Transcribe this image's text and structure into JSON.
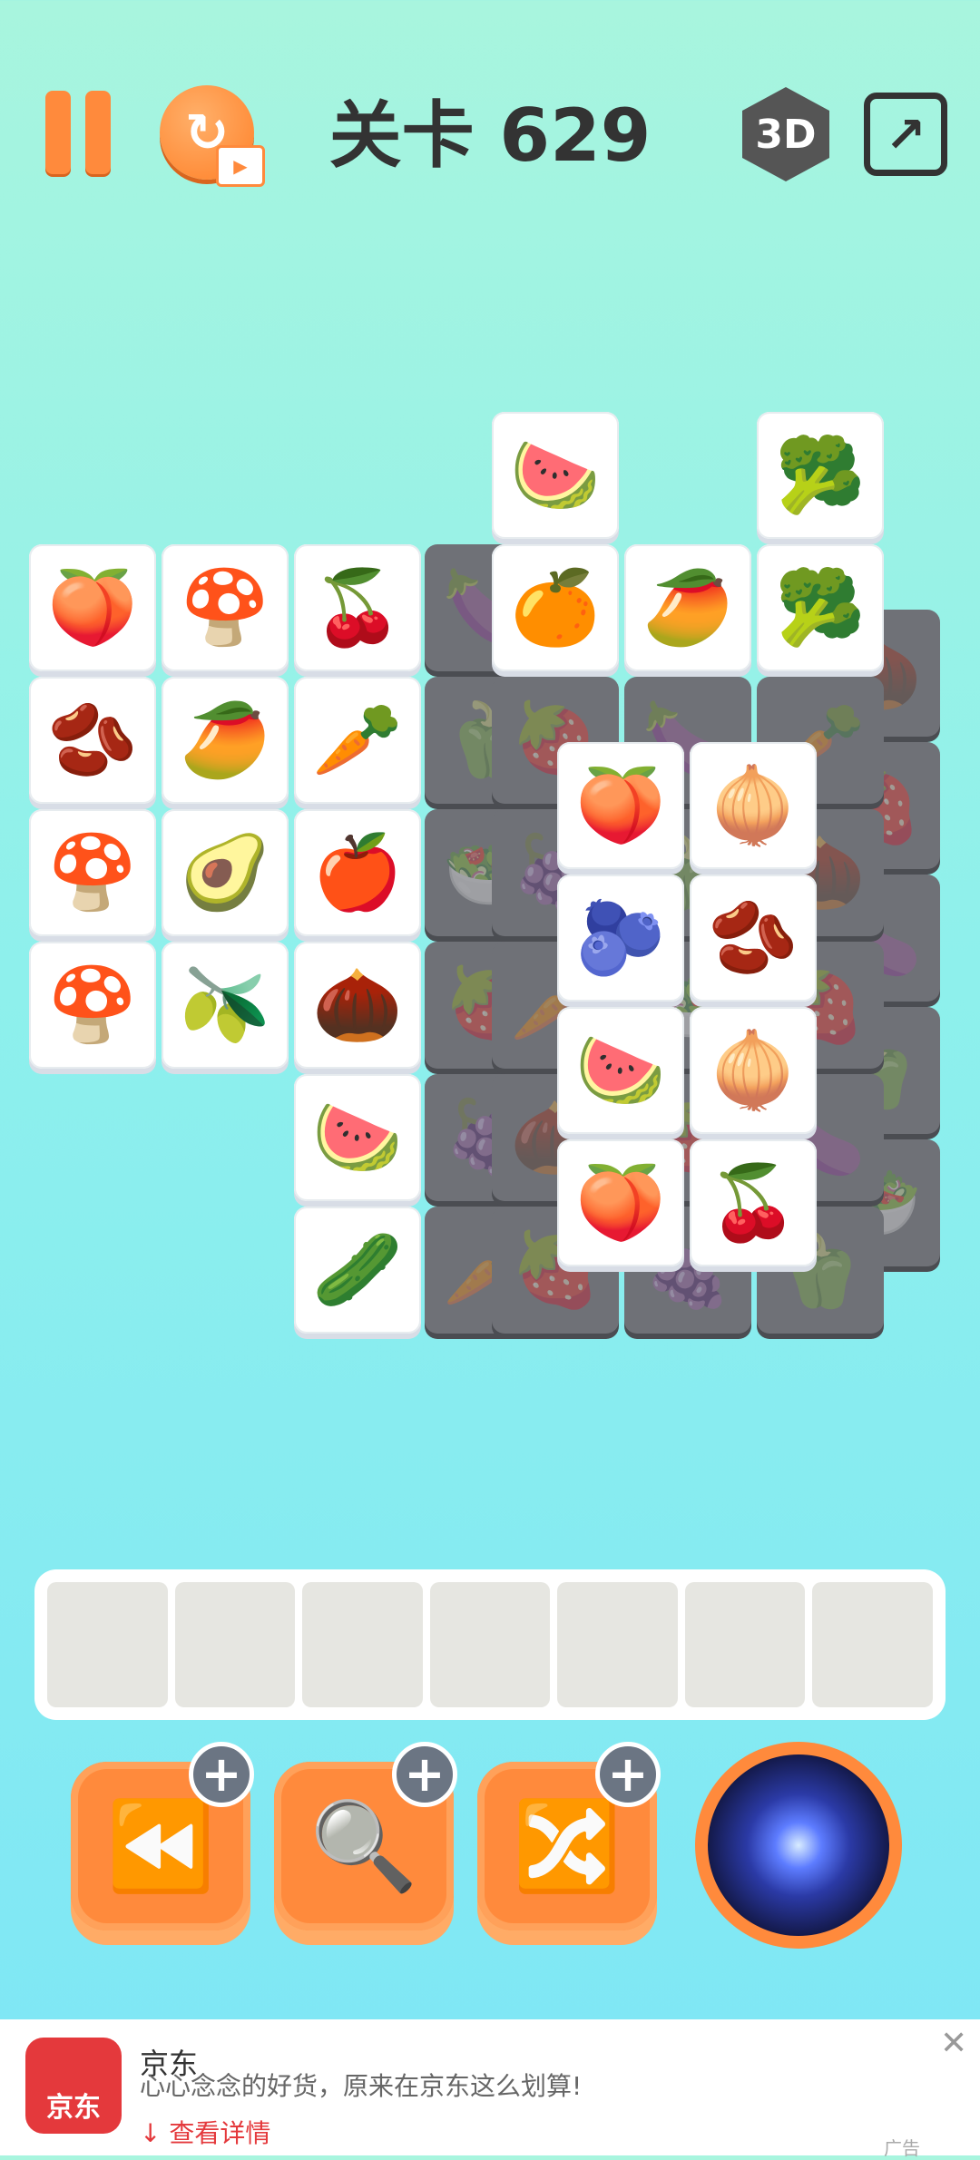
{
  "header": {
    "level_title": "关卡 629",
    "mode_label": "3D",
    "restart_icon": "↻",
    "share_icon": "↗"
  },
  "board": {
    "left_columns": [
      [
        "🍑",
        "🫘",
        "🍄",
        "🍄"
      ],
      [
        "🍄",
        "🥭",
        "🥑",
        "🫒"
      ],
      [
        "🍒",
        "🥕",
        "🍎",
        "🌰",
        "🍉",
        "🥒"
      ]
    ],
    "top_row": [
      "🍉",
      "🥦",
      "🍊",
      "🥭",
      "🥦"
    ],
    "center_stack": [
      "🍑",
      "🧅",
      "🫐",
      "🫘",
      "🍉",
      "🧅",
      "🍑",
      "🍒"
    ],
    "covered": [
      "🍆",
      "🫑",
      "🥗",
      "🍓",
      "🍇",
      "🥕",
      "🌰",
      "🍓"
    ]
  },
  "tray": {
    "slots": 7
  },
  "tools": {
    "undo_icon": "⏪",
    "hint_icon": "🔍",
    "shuffle_icon": "🔀",
    "plus": "+"
  },
  "ad": {
    "title": "京东",
    "description": "心心念念的好货，原来在京东这么划算!",
    "link": "↓ 查看详情",
    "logo_text": "京东",
    "tag": "广告",
    "close": "✕"
  }
}
